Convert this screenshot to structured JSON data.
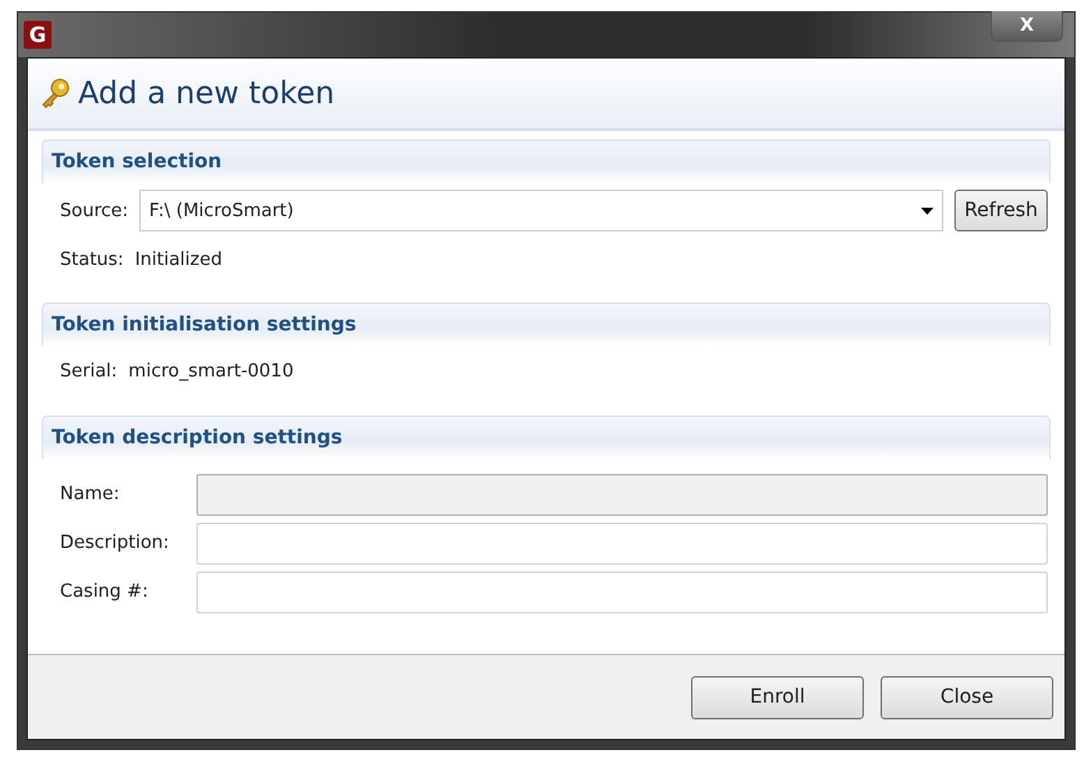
{
  "window": {
    "app_icon": "G",
    "close": "X"
  },
  "header": {
    "title": "Add a new token"
  },
  "token_selection": {
    "title": "Token selection",
    "source_label": "Source:",
    "source_value": "F:\\ (MicroSmart)",
    "refresh": "Refresh",
    "status_label": "Status:",
    "status_value": "Initialized"
  },
  "token_initialisation": {
    "title": "Token initialisation settings",
    "serial_label": "Serial:",
    "serial_value": "micro_smart-0010"
  },
  "token_description": {
    "title": "Token description settings",
    "fields": [
      {
        "label": "Name:",
        "disabled": true
      },
      {
        "label": "Description:",
        "disabled": false
      },
      {
        "label": "Casing #:",
        "disabled": false
      }
    ]
  },
  "buttons": [
    "Enroll",
    "Close"
  ]
}
